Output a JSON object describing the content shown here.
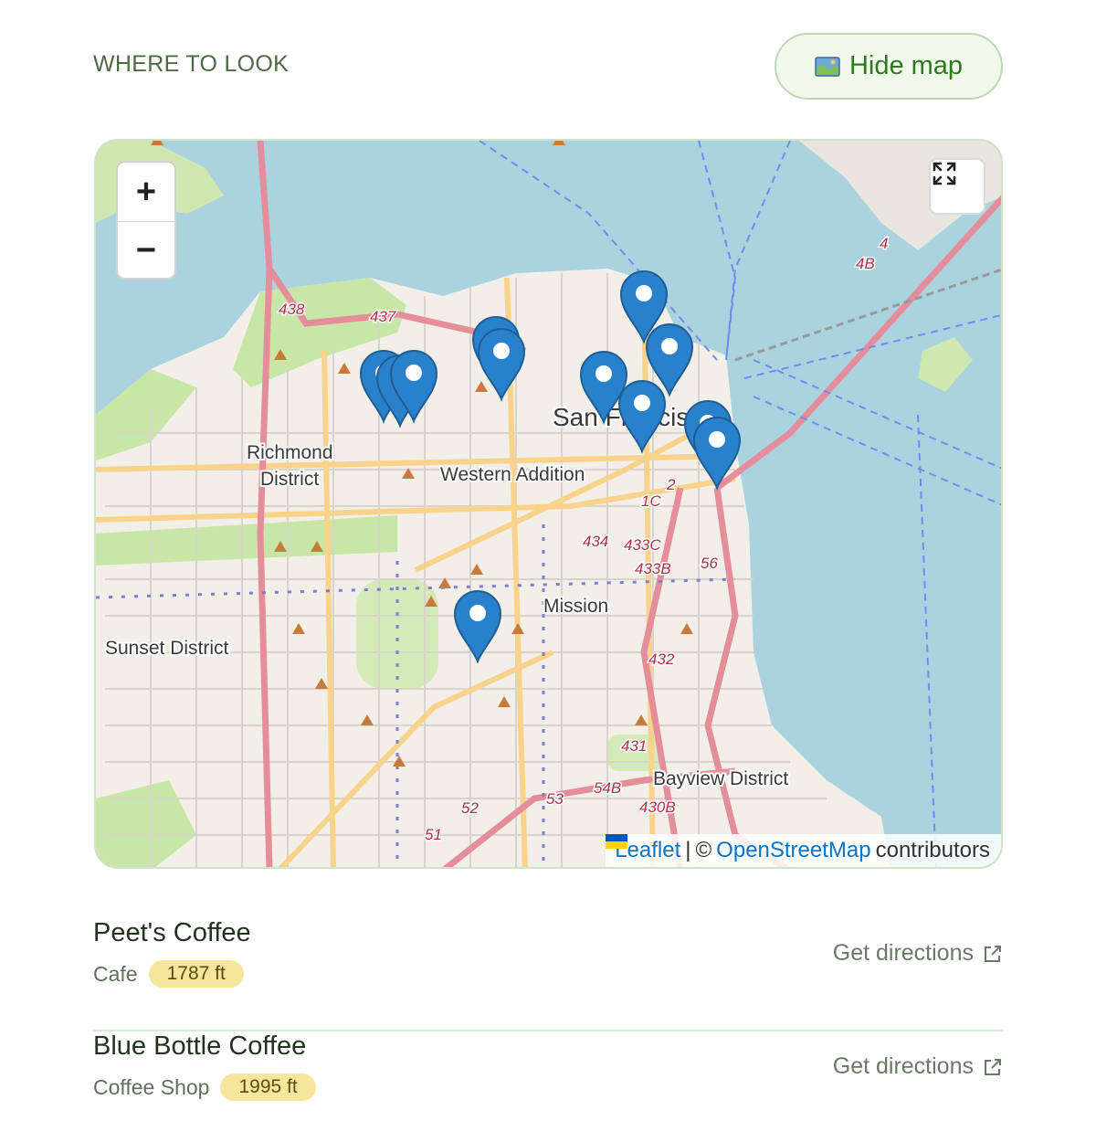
{
  "header": {
    "section_label": "WHERE TO LOOK",
    "toggle_label": "Hide map"
  },
  "map": {
    "zoom_in": "+",
    "zoom_out": "−",
    "place_labels": [
      "Richmond",
      "District",
      "Western Addition",
      "San Francisco",
      "Mission",
      "Sunset District",
      "Bayview District"
    ],
    "road_labels": [
      "438",
      "437",
      "434",
      "433C",
      "433B",
      "56",
      "432",
      "431",
      "430B",
      "54B",
      "53",
      "52",
      "51",
      "1C",
      "2",
      "4",
      "4B"
    ],
    "attribution": {
      "leaflet": "Leaflet",
      "separator": "|",
      "copyright": "©",
      "osm": "OpenStreetMap",
      "suffix": "contributors"
    },
    "colors": {
      "water": "#aad3df",
      "land": "#f2efe9",
      "park": "#c8e6a6",
      "motorway": "#e68d9b",
      "primary": "#f9d28c",
      "marker": "#2a81cb"
    }
  },
  "places": [
    {
      "name": "Peet's Coffee",
      "type": "Cafe",
      "distance": "1787 ft",
      "action": "Get directions"
    },
    {
      "name": "Blue Bottle Coffee",
      "type": "Coffee Shop",
      "distance": "1995 ft",
      "action": "Get directions"
    }
  ]
}
